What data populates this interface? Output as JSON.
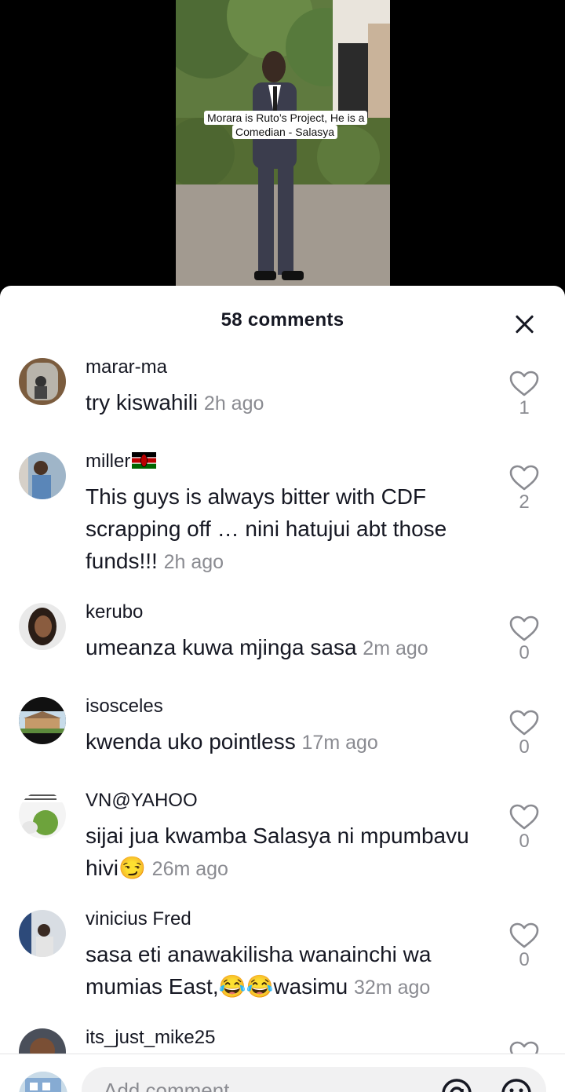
{
  "video": {
    "caption": "Morara is Ruto’s Project, He is a Comedian - Salasya"
  },
  "sheet": {
    "title": "58 comments"
  },
  "comments": [
    {
      "username": "marar-ma",
      "text": "try kiswahili",
      "time": "2h ago",
      "likes": "1"
    },
    {
      "username": "miller",
      "text": "This guys is always bitter with CDF scrapping off … nini hatujui abt those funds!!!",
      "time": "2h ago",
      "likes": "2"
    },
    {
      "username": "kerubo",
      "text": "umeanza kuwa mjinga sasa",
      "time": "2m ago",
      "likes": "0"
    },
    {
      "username": "isosceles",
      "text": "kwenda uko pointless",
      "time": "17m ago",
      "likes": "0"
    },
    {
      "username": "VN@YAHOO",
      "text": "sijai jua kwamba Salasya ni mpumbavu hivi😏",
      "time": "26m ago",
      "likes": "0"
    },
    {
      "username": "vinicius Fred",
      "text": "sasa eti anawakilisha wanainchi wa mumias East,😂😂wasimu",
      "time": "32m ago",
      "likes": "0"
    },
    {
      "username": "its_just_mike25",
      "text": "",
      "time": "",
      "likes": ""
    }
  ],
  "input": {
    "placeholder": "Add comment..."
  },
  "icons": {
    "close": "close-icon",
    "like": "heart-outline-icon",
    "mention": "at-icon",
    "emoji": "emoji-icon"
  },
  "colors": {
    "text": "#161823",
    "secondary": "#8a8b91"
  }
}
